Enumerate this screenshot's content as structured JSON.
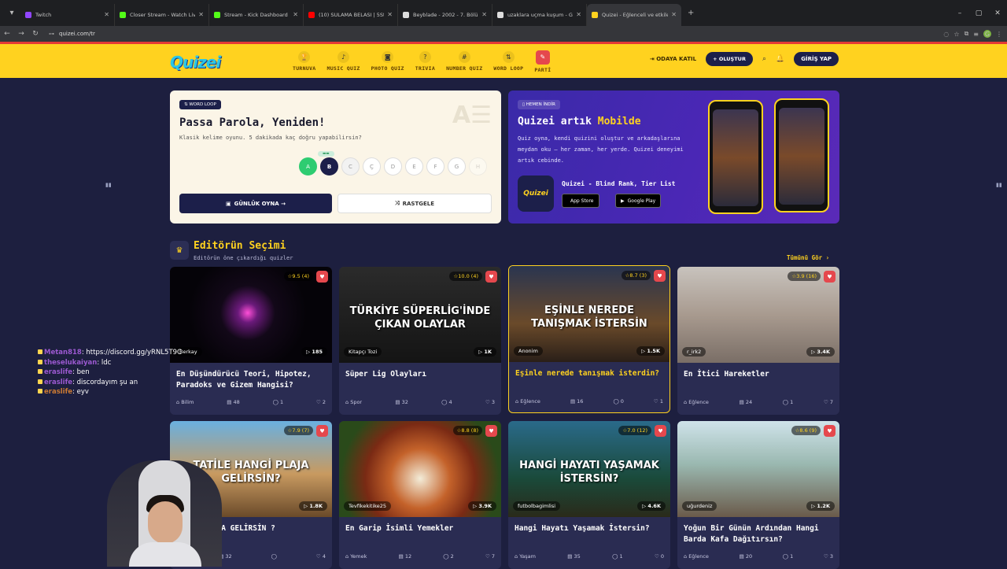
{
  "browser": {
    "tabs": [
      {
        "title": "Twitch",
        "color": "#9146ff"
      },
      {
        "title": "Closer Stream - Watch Live on Kick",
        "color": "#53fc18"
      },
      {
        "title": "Stream - Kick Dashboard",
        "color": "#53fc18"
      },
      {
        "title": "(10) SULAMA BELASI | 5Strider...",
        "color": "#ff0000"
      },
      {
        "title": "Beyblade - 2002 - 7. Bölüm",
        "color": "#dddddd"
      },
      {
        "title": "uzaklara uçma kuşum - Google...",
        "color": "#dddddd"
      },
      {
        "title": "Quizei - Eğlenceli ve etkileşimli",
        "color": "#ffd21f"
      }
    ],
    "url": "quizei.com/tr"
  },
  "site": {
    "logo": "Quizei",
    "nav": [
      {
        "label": "TURNUVA",
        "icon": "trophy-icon",
        "glyph": "🏆"
      },
      {
        "label": "MUSIC QUIZ",
        "icon": "music-icon",
        "glyph": "♪"
      },
      {
        "label": "PHOTO QUIZ",
        "icon": "camera-icon",
        "glyph": "◙"
      },
      {
        "label": "TRIVIA",
        "icon": "question-icon",
        "glyph": "?"
      },
      {
        "label": "NUMBER QUIZ",
        "icon": "hash-icon",
        "glyph": "#"
      },
      {
        "label": "WORD LOOP",
        "icon": "sort-icon",
        "glyph": "⇅"
      },
      {
        "label": "PARTİ",
        "icon": "party-icon",
        "glyph": "✎"
      }
    ],
    "join_room": "ODAYA KATIL",
    "create": "+ OLUŞTUR",
    "login": "GİRİŞ YAP"
  },
  "word_card": {
    "badge": "WORD LOOP",
    "title": "Passa Parola, Yeniden!",
    "subtitle": "Klasik kelime oyunu. 5 dakikada kaç doğru yapabilirsin?",
    "letters": [
      "A",
      "B",
      "C",
      "Ç",
      "D",
      "E",
      "F",
      "G",
      "H"
    ],
    "daily_btn": "GÜNLÜK OYNA →",
    "random_btn": "RASTGELE"
  },
  "mobile_card": {
    "badge": "HEMEN İNDİR",
    "title_a": "Quizei artık ",
    "title_b": "Mobilde",
    "desc": "Quiz oyna, kendi quizini oluştur ve arkadaşlarına meydan oku — her zaman, her yerde. Quizei deneyimi artık cebinde.",
    "app_name": "Quizei - Blind Rank, Tier List",
    "app_icon_text": "Quizei",
    "app_store": "App Store",
    "google_play": "Google Play"
  },
  "section": {
    "title": "Editörün Seçimi",
    "subtitle": "Editörün öne çıkardığı quizler",
    "see_all": "Tümünü Gör ›"
  },
  "cards": [
    {
      "rating": "☆9.5 (4)",
      "author": "Berkay",
      "plays": "▷ 185",
      "title": "En Düşündürücü Teori, Hipotez, Paradoks ve Gizem Hangisi?",
      "category": "Bilim",
      "questions": "48",
      "comments": "1",
      "likes": "2",
      "bg": "radial-gradient(circle at 48% 48%,#ff4fd8 0,#6a1a7a 10%,#120818 28%,#050308 60%)",
      "overlay": ""
    },
    {
      "rating": "☆10.0 (4)",
      "author": "Kitapçı Tozi",
      "plays": "▷ 1K",
      "title": "Süper Lig Olayları",
      "category": "Spor",
      "questions": "32",
      "comments": "4",
      "likes": "3",
      "bg": "linear-gradient(#2b2b2b,#141414)",
      "overlay": "TÜRKİYE SÜPERLİG'İNDE ÇIKAN OLAYLAR"
    },
    {
      "rating": "☆8.7 (3)",
      "author": "Anonim",
      "plays": "▷ 1.5K",
      "title": "Eşinle nerede tanışmak isterdin?",
      "category": "Eğlence",
      "questions": "16",
      "comments": "0",
      "likes": "1",
      "bg": "linear-gradient(#2a3550,#6a4a2a 60%,#2a1f18)",
      "overlay": "EŞİNLE NEREDE TANIŞMAK İSTERSİN"
    },
    {
      "rating": "☆3.9 (16)",
      "author": "r_irk2",
      "plays": "▷ 3.4K",
      "title": "En İtici Hareketler",
      "category": "Eğlence",
      "questions": "24",
      "comments": "1",
      "likes": "7",
      "bg": "linear-gradient(#c8c3bd,#a89a8f 50%,#7a6e66)",
      "overlay": ""
    },
    {
      "rating": "☆7.9 (7)",
      "author": "",
      "plays": "▷ 1.8K",
      "title": "Hangi PLAJA GELİRSİN ?",
      "category": "",
      "questions": "32",
      "comments": "",
      "likes": "4",
      "bg": "linear-gradient(#6ab0e0,#c89a60 55%,#6a4a2a)",
      "overlay": "TATİLE HANGİ PLAJA GELİRSİN?"
    },
    {
      "rating": "☆8.8 (8)",
      "author": "Tevfikekitike25",
      "plays": "▷ 3.9K",
      "title": "En Garip İsimli Yemekler",
      "category": "Yemek",
      "questions": "12",
      "comments": "2",
      "likes": "7",
      "bg": "radial-gradient(circle at 50% 60%,#f3ecd8 0,#c4622a 30%,#7a2a14 55%,#2a4a1a 80%)",
      "overlay": ""
    },
    {
      "rating": "☆7.0 (12)",
      "author": "futbolbagimlisi",
      "plays": "▷ 4.6K",
      "title": "Hangi Hayatı Yaşamak İstersin?",
      "category": "Yaşam",
      "questions": "35",
      "comments": "1",
      "likes": "0",
      "bg": "linear-gradient(#2a6a8a,#1a4a3a 60%,#2a2a1a)",
      "overlay": "HANGİ HAYATI YAŞAMAK İSTERSİN?"
    },
    {
      "rating": "☆8.6 (9)",
      "author": "uğurdeniz",
      "plays": "▷ 1.2K",
      "title": "Yoğun Bir Günün Ardından Hangi Barda Kafa Dağıtırsın?",
      "category": "Eğlence",
      "questions": "20",
      "comments": "1",
      "likes": "3",
      "bg": "linear-gradient(#cfe3ea,#9ab8b0 45%,#6a5a4a)",
      "overlay": ""
    }
  ],
  "chat": [
    {
      "user": "Metan818",
      "msg": ": https://discord.gg/yRNL5T9C",
      "cls": "u"
    },
    {
      "user": "theselukaiyan",
      "msg": ": ldc",
      "cls": "u"
    },
    {
      "user": "eraslife",
      "msg": ": ben",
      "cls": "u"
    },
    {
      "user": "eraslife",
      "msg": ": discordayım şu an",
      "cls": "u"
    },
    {
      "user": "eraslife",
      "msg": ": eyv",
      "cls": "u2"
    }
  ]
}
